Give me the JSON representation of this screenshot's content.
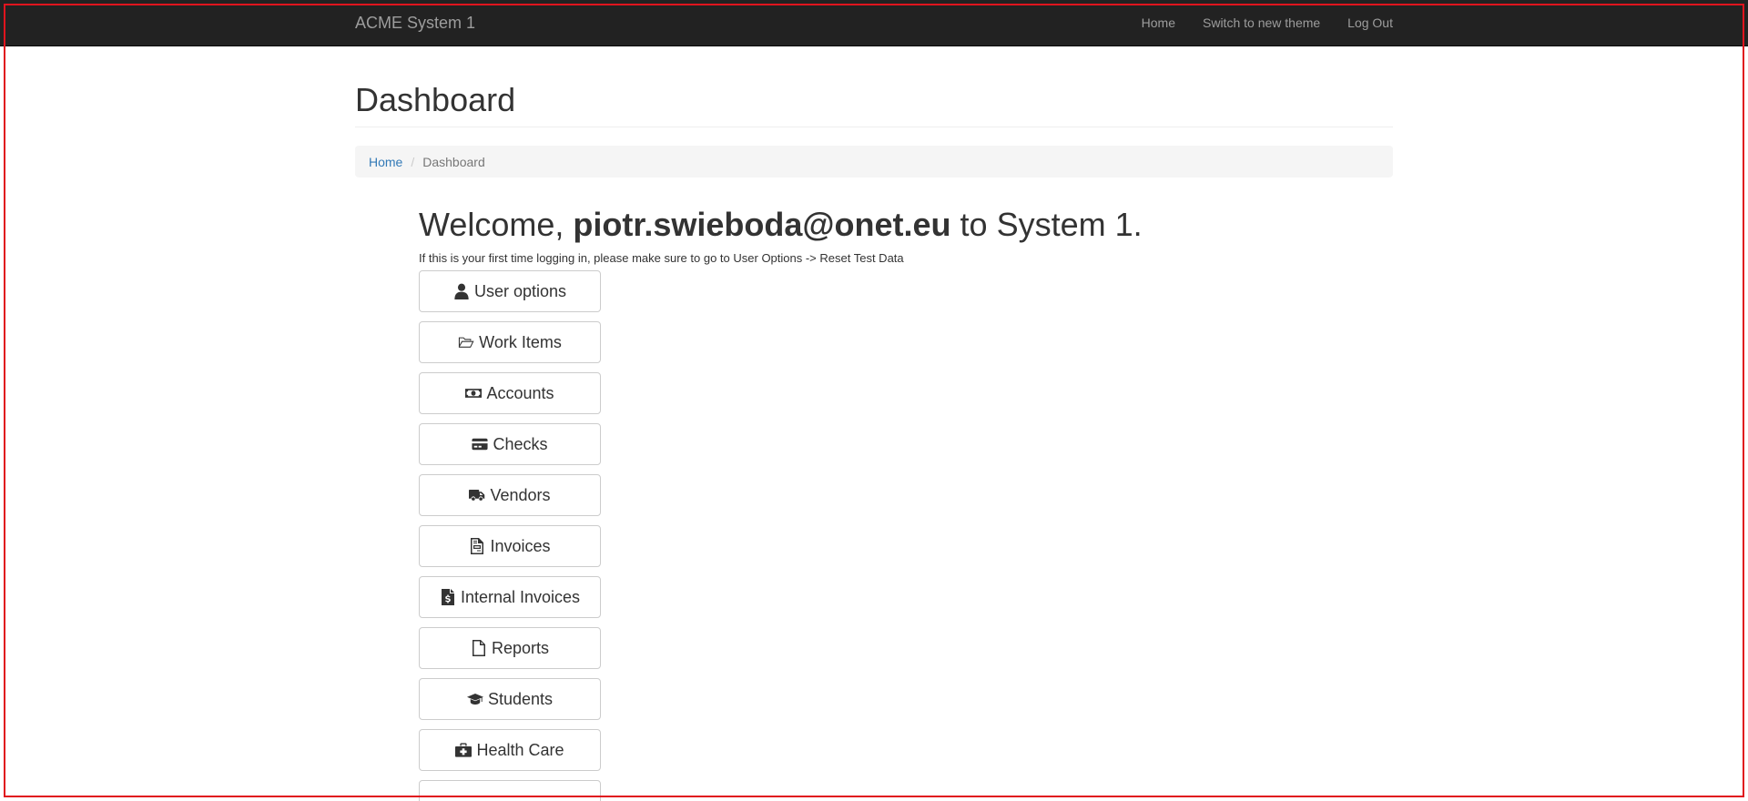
{
  "navbar": {
    "brand": "ACME System 1",
    "links": [
      {
        "label": "Home"
      },
      {
        "label": "Switch to new theme"
      },
      {
        "label": "Log Out"
      }
    ]
  },
  "page": {
    "title": "Dashboard"
  },
  "breadcrumb": {
    "home": "Home",
    "separator": "/",
    "current": "Dashboard"
  },
  "welcome": {
    "prefix": "Welcome, ",
    "user": "piotr.swieboda@onet.eu",
    "suffix": " to System 1."
  },
  "notice": "If this is your first time logging in, please make sure to go to User Options -> Reset Test Data",
  "buttons": [
    {
      "label": "User options",
      "icon": "user-icon"
    },
    {
      "label": "Work Items",
      "icon": "folder-open-icon"
    },
    {
      "label": "Accounts",
      "icon": "money-bill-icon"
    },
    {
      "label": "Checks",
      "icon": "credit-card-icon"
    },
    {
      "label": "Vendors",
      "icon": "truck-icon"
    },
    {
      "label": "Invoices",
      "icon": "file-invoice-icon"
    },
    {
      "label": "Internal Invoices",
      "icon": "file-invoice-dollar-icon"
    },
    {
      "label": "Reports",
      "icon": "file-icon"
    },
    {
      "label": "Students",
      "icon": "graduation-cap-icon"
    },
    {
      "label": "Health Care",
      "icon": "medkit-icon"
    }
  ]
}
